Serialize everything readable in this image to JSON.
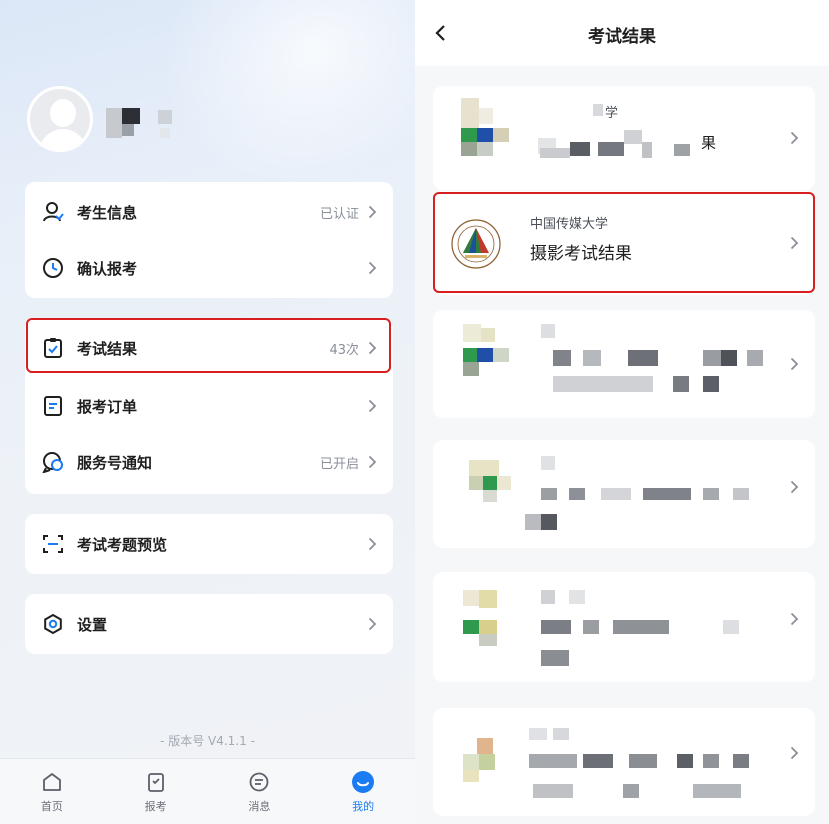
{
  "left": {
    "menu_group1": [
      {
        "label": "考生信息",
        "value": "已认证",
        "icon": "user-icon"
      },
      {
        "label": "确认报考",
        "value": "",
        "icon": "clock-icon"
      }
    ],
    "menu_group2": [
      {
        "label": "考试结果",
        "value": "43次",
        "icon": "clipboard-check-icon"
      },
      {
        "label": "报考订单",
        "value": "",
        "icon": "document-icon"
      },
      {
        "label": "服务号通知",
        "value": "已开启",
        "icon": "chat-icon"
      }
    ],
    "menu_group3": [
      {
        "label": "考试考题预览",
        "value": "",
        "icon": "scan-icon"
      }
    ],
    "menu_group4": [
      {
        "label": "设置",
        "value": "",
        "icon": "gear-icon"
      }
    ],
    "version": "- 版本号 V4.1.1 -",
    "tabs": [
      {
        "label": "首页",
        "icon": "home-icon",
        "active": false
      },
      {
        "label": "报考",
        "icon": "form-icon",
        "active": false
      },
      {
        "label": "消息",
        "icon": "message-icon",
        "active": false
      },
      {
        "label": "我的",
        "icon": "profile-icon",
        "active": true
      }
    ]
  },
  "right": {
    "title": "考试结果",
    "results": [
      {
        "school": "中国传媒大学",
        "title": "摄影考试结果"
      }
    ],
    "blurred_card1": {
      "school_fragment": "学",
      "title_fragment": "果"
    }
  },
  "colors": {
    "accent": "#1a7bf2",
    "highlight": "#d81e1e",
    "text": "#1f1f1f",
    "muted": "#8a8f99"
  }
}
